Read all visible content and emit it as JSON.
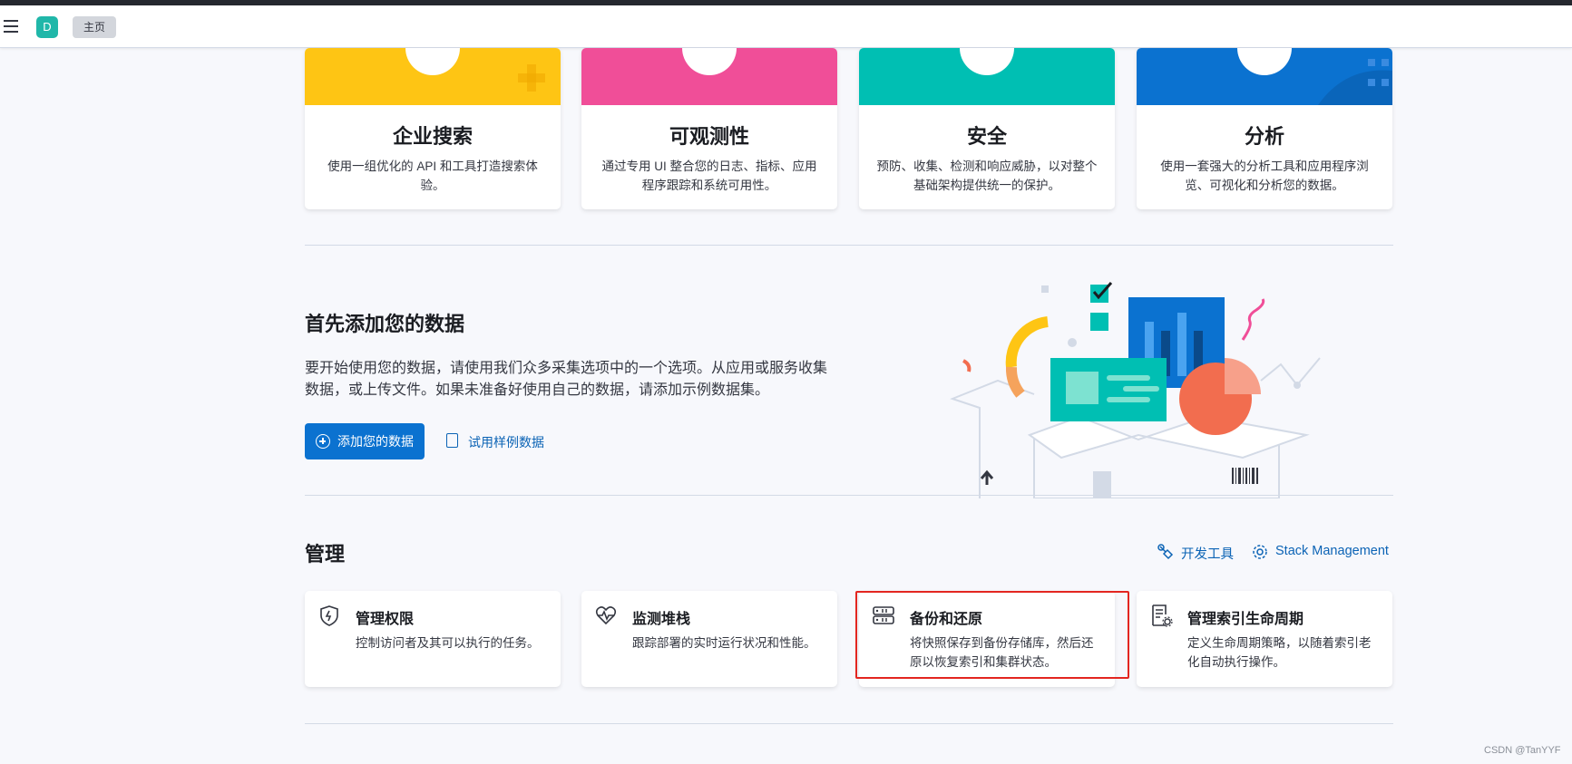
{
  "header": {
    "avatar_letter": "D",
    "breadcrumb": "主页"
  },
  "solutions": [
    {
      "title": "企业搜索",
      "desc": "使用一组优化的 API 和工具打造搜索体验。",
      "color": "#fec514",
      "icon": "plus-icon"
    },
    {
      "title": "可观测性",
      "desc": "通过专用 UI 整合您的日志、指标、应用程序跟踪和系统可用性。",
      "color": "#f04e98",
      "icon": "observability-icon"
    },
    {
      "title": "安全",
      "desc": "预防、收集、检测和响应威胁，以对整个基础架构提供统一的保护。",
      "color": "#00bfb3",
      "icon": "security-icon"
    },
    {
      "title": "分析",
      "desc": "使用一套强大的分析工具和应用程序浏览、可视化和分析您的数据。",
      "color": "#0b72d0",
      "icon": "grid-icon"
    }
  ],
  "add_data": {
    "title": "首先添加您的数据",
    "desc": "要开始使用您的数据，请使用我们众多采集选项中的一个选项。从应用或服务收集数据，或上传文件。如果未准备好使用自己的数据，请添加示例数据集。",
    "primary_button": "添加您的数据",
    "sample_link": "试用样例数据"
  },
  "management": {
    "title": "管理",
    "dev_tools": "开发工具",
    "stack_management": "Stack Management",
    "cards": [
      {
        "title": "管理权限",
        "desc": "控制访问者及其可以执行的任务。",
        "icon": "shield-icon"
      },
      {
        "title": "监测堆栈",
        "desc": "跟踪部署的实时运行状况和性能。",
        "icon": "heartbeat-icon"
      },
      {
        "title": "备份和还原",
        "desc": "将快照保存到备份存储库，然后还原以恢复索引和集群状态。",
        "icon": "storage-icon"
      },
      {
        "title": "管理索引生命周期",
        "desc": "定义生命周期策略，以随着索引老化自动执行操作。",
        "icon": "index-lifecycle-icon"
      }
    ]
  },
  "watermark": "CSDN @TanYYF",
  "colors": {
    "accent": "#0b72d0",
    "link": "#0b63b5",
    "highlight": "#e32620"
  }
}
